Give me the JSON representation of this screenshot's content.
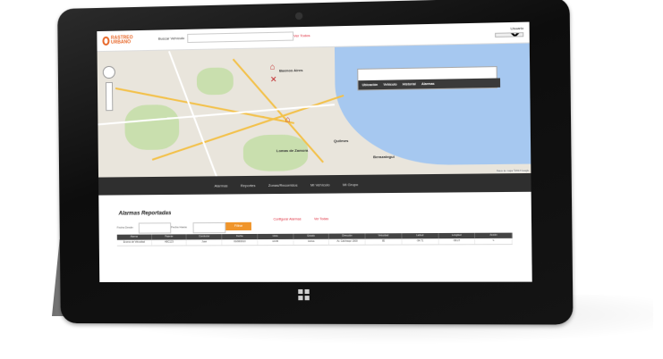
{
  "app": {
    "logo_line1": "RASTREO",
    "logo_line2": "URBANO"
  },
  "header": {
    "search_label": "Buscar Vehículo",
    "search_placeholder": "",
    "link_all": "Ver Todos",
    "user_label": "Usuario",
    "user_select": ""
  },
  "map": {
    "cities": [
      "Buenos Aires",
      "Lomas de Zamora",
      "Quilmes",
      "Berazategui"
    ],
    "panel_tabs": [
      "Ubicación",
      "Vehículo",
      "Historial",
      "Alarmas"
    ],
    "attribution": "Datos de mapa ©2013 Google"
  },
  "nav": {
    "items": [
      "Alarmas",
      "Reportes",
      "Zonas/Recorridos",
      "Mi Vehículo",
      "Mi Grupo"
    ]
  },
  "alarms": {
    "title": "Alarmas Reportadas",
    "from_label": "Fecha Desde:",
    "to_label": "Fecha Hasta:",
    "filter_button": "Filtrar",
    "link_config": "Configurar Alarmas",
    "link_all": "Ver Todas",
    "columns": [
      "Alarma",
      "Patente",
      "Conductor",
      "Fecha",
      "Hora",
      "Estado",
      "Dirección",
      "Velocidad",
      "Latitud",
      "Longitud",
      "Acción"
    ],
    "rows": [
      [
        "Exceso de Velocidad",
        "ABC123",
        "Juan",
        "01/08/2013",
        "10:05",
        "Activa",
        "Av. Calchaquí 1500",
        "85",
        "-34.71",
        "-58.27",
        ""
      ]
    ]
  }
}
